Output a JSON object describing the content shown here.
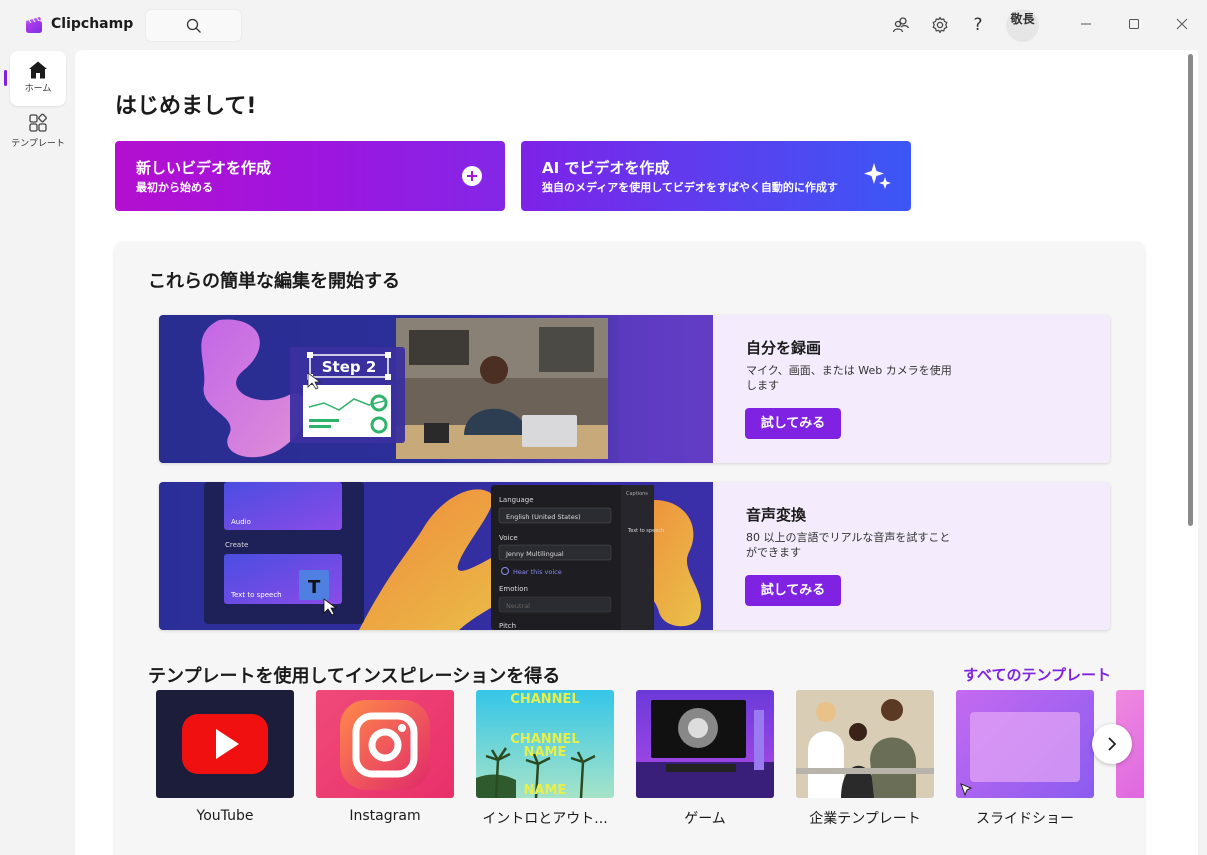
{
  "app": {
    "title": "Clipchamp"
  },
  "header": {
    "avatar_text": "敬長",
    "help_label": "?"
  },
  "sidebar": {
    "items": [
      {
        "label": "ホーム",
        "icon": "home-icon",
        "active": true
      },
      {
        "label": "テンプレート",
        "icon": "templates-icon",
        "active": false
      }
    ]
  },
  "main": {
    "greeting": "はじめまして!",
    "cta": [
      {
        "title": "新しいビデオを作成",
        "subtitle": "最初から始める",
        "icon": "plus-icon"
      },
      {
        "title": "AI でビデオを作成",
        "subtitle": "独自のメディアを使用してビデオをすばやく自動的に作成す",
        "icon": "sparkle-icon"
      }
    ],
    "edit_section": {
      "title": "これらの簡単な編集を開始する",
      "cards": [
        {
          "title": "自分を録画",
          "description": "マイク、画面、または Web カメラを使用します",
          "button": "試してみる",
          "image_text": {
            "step": "Step 2"
          }
        },
        {
          "title": "音声変換",
          "description": "80 以上の言語でリアルな音声を試すことができます",
          "button": "試してみる",
          "image_text": {
            "audio": "Audio",
            "create": "Create",
            "tts": "Text to speech",
            "captions": "Captions",
            "tts_tab": "Text to speech",
            "language_label": "Language",
            "language_value": "English (United States)",
            "voice_label": "Voice",
            "voice_value": "Jenny Multilingual",
            "hear": "Hear this voice",
            "emotion_label": "Emotion",
            "emotion_value": "Neutral",
            "pitch_label": "Pitch"
          }
        }
      ]
    },
    "templates": {
      "title": "テンプレートを使用してインスピレーションを得る",
      "all_link": "すべてのテンプレート",
      "items": [
        {
          "label": "YouTube"
        },
        {
          "label": "Instagram"
        },
        {
          "label": "イントロとアウト...",
          "thumb_text": [
            "CHANNEL",
            "CHANNEL",
            "NAME",
            "NAME"
          ]
        },
        {
          "label": "ゲーム"
        },
        {
          "label": "企業テンプレート"
        },
        {
          "label": "スライドショー"
        }
      ]
    }
  },
  "colors": {
    "accent": "#7e22e0",
    "cta_new": "#a616d8",
    "cta_ai": "#5b3ff0",
    "card_bg": "#f4ecfc"
  }
}
